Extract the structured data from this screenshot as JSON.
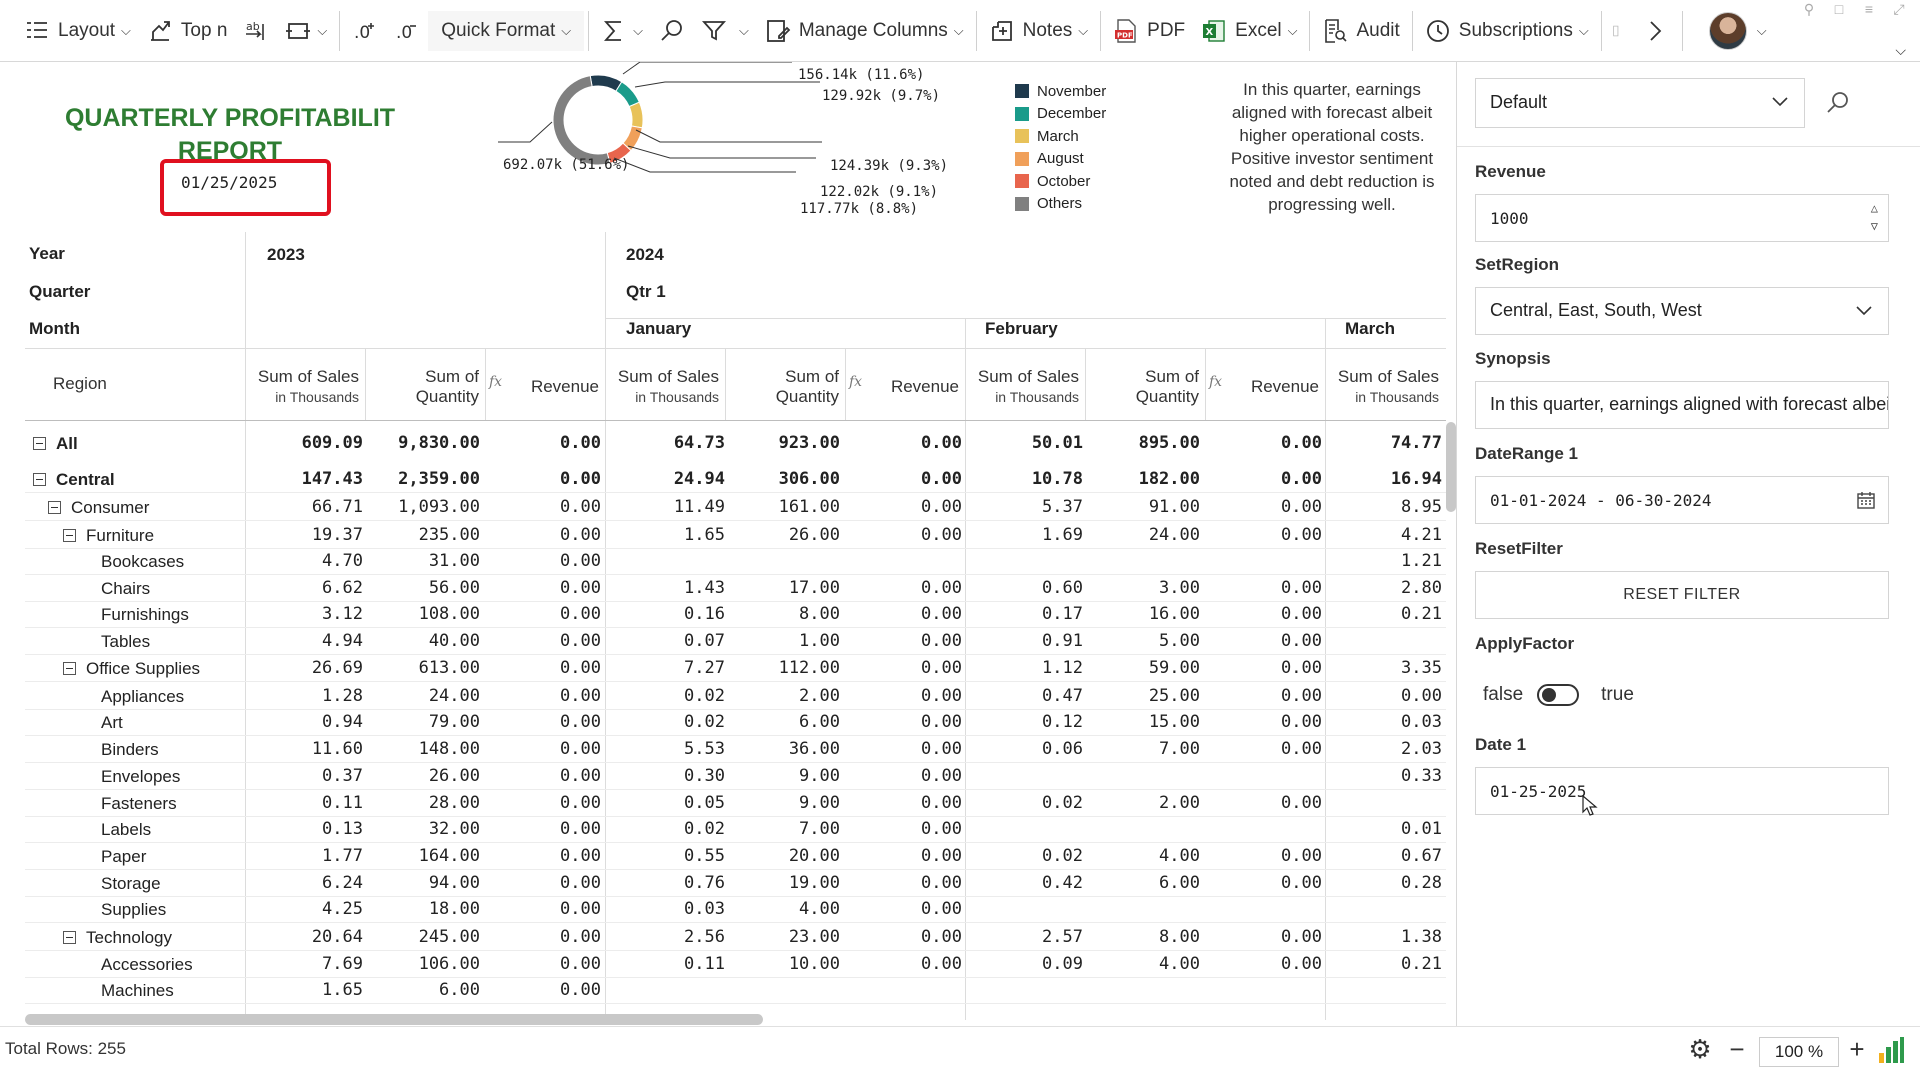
{
  "toolbar": {
    "layout": "Layout",
    "top_n": "Top n",
    "quick_format": "Quick Format",
    "manage_columns": "Manage Columns",
    "notes": "Notes",
    "pdf": "PDF",
    "excel": "Excel",
    "audit": "Audit",
    "subscriptions": "Subscriptions"
  },
  "report": {
    "title": "QUARTERLY PROFITABILIT REPORT",
    "date": "01/25/2025",
    "synopsis_text": "In this quarter, earnings aligned with forecast albeit higher operational costs. Positive investor sentiment noted and debt reduction is progressing well."
  },
  "donut": {
    "slices": [
      {
        "name": "November",
        "value": 156.14,
        "label": "156.14k (11.6%)",
        "color": "#1f3a4d"
      },
      {
        "name": "December",
        "value": 129.92,
        "label": "129.92k (9.7%)",
        "color": "#1a9b8a"
      },
      {
        "name": "March",
        "value": 124.39,
        "label": "124.39k (9.3%)",
        "color": "#e8c25a"
      },
      {
        "name": "August",
        "value": 122.02,
        "label": "122.02k (9.1%)",
        "color": "#f0a05a"
      },
      {
        "name": "October",
        "value": 117.77,
        "label": "117.77k (8.8%)",
        "color": "#e8654d"
      },
      {
        "name": "Others",
        "value": 692.07,
        "label": "692.07k (51.6%)",
        "color": "#808080"
      }
    ]
  },
  "grid": {
    "dims": {
      "year": "Year",
      "quarter": "Quarter",
      "month": "Month",
      "region": "Region"
    },
    "years": [
      "2023",
      "2024"
    ],
    "quarter": "Qtr 1",
    "months": [
      "January",
      "February",
      "March"
    ],
    "measures": {
      "sales": "Sum of Sales",
      "sales_sub": "in Thousands",
      "qty_a": "Sum of",
      "qty_b": "Quantity",
      "revenue": "Revenue",
      "fx": "fx"
    },
    "rows": [
      {
        "label": "All",
        "level": 0,
        "bold": true,
        "expander": true,
        "values": [
          "609.09",
          "9,830.00",
          "0.00",
          "64.73",
          "923.00",
          "0.00",
          "50.01",
          "895.00",
          "0.00",
          "74.77"
        ]
      },
      {
        "label": "Central",
        "level": 0,
        "bold": true,
        "expander": true,
        "values": [
          "147.43",
          "2,359.00",
          "0.00",
          "24.94",
          "306.00",
          "0.00",
          "10.78",
          "182.00",
          "0.00",
          "16.94"
        ]
      },
      {
        "label": "Consumer",
        "level": 1,
        "bold": false,
        "expander": true,
        "values": [
          "66.71",
          "1,093.00",
          "0.00",
          "11.49",
          "161.00",
          "0.00",
          "5.37",
          "91.00",
          "0.00",
          "8.95"
        ]
      },
      {
        "label": "Furniture",
        "level": 2,
        "bold": false,
        "expander": true,
        "values": [
          "19.37",
          "235.00",
          "0.00",
          "1.65",
          "26.00",
          "0.00",
          "1.69",
          "24.00",
          "0.00",
          "4.21"
        ]
      },
      {
        "label": "Bookcases",
        "level": 3,
        "bold": false,
        "expander": false,
        "values": [
          "4.70",
          "31.00",
          "0.00",
          "",
          "",
          "",
          "",
          "",
          "",
          "1.21"
        ]
      },
      {
        "label": "Chairs",
        "level": 3,
        "bold": false,
        "expander": false,
        "values": [
          "6.62",
          "56.00",
          "0.00",
          "1.43",
          "17.00",
          "0.00",
          "0.60",
          "3.00",
          "0.00",
          "2.80"
        ]
      },
      {
        "label": "Furnishings",
        "level": 3,
        "bold": false,
        "expander": false,
        "values": [
          "3.12",
          "108.00",
          "0.00",
          "0.16",
          "8.00",
          "0.00",
          "0.17",
          "16.00",
          "0.00",
          "0.21"
        ]
      },
      {
        "label": "Tables",
        "level": 3,
        "bold": false,
        "expander": false,
        "values": [
          "4.94",
          "40.00",
          "0.00",
          "0.07",
          "1.00",
          "0.00",
          "0.91",
          "5.00",
          "0.00",
          ""
        ]
      },
      {
        "label": "Office Supplies",
        "level": 2,
        "bold": false,
        "expander": true,
        "values": [
          "26.69",
          "613.00",
          "0.00",
          "7.27",
          "112.00",
          "0.00",
          "1.12",
          "59.00",
          "0.00",
          "3.35"
        ]
      },
      {
        "label": "Appliances",
        "level": 3,
        "bold": false,
        "expander": false,
        "values": [
          "1.28",
          "24.00",
          "0.00",
          "0.02",
          "2.00",
          "0.00",
          "0.47",
          "25.00",
          "0.00",
          "0.00"
        ]
      },
      {
        "label": "Art",
        "level": 3,
        "bold": false,
        "expander": false,
        "values": [
          "0.94",
          "79.00",
          "0.00",
          "0.02",
          "6.00",
          "0.00",
          "0.12",
          "15.00",
          "0.00",
          "0.03"
        ]
      },
      {
        "label": "Binders",
        "level": 3,
        "bold": false,
        "expander": false,
        "values": [
          "11.60",
          "148.00",
          "0.00",
          "5.53",
          "36.00",
          "0.00",
          "0.06",
          "7.00",
          "0.00",
          "2.03"
        ]
      },
      {
        "label": "Envelopes",
        "level": 3,
        "bold": false,
        "expander": false,
        "values": [
          "0.37",
          "26.00",
          "0.00",
          "0.30",
          "9.00",
          "0.00",
          "",
          "",
          "",
          "0.33"
        ]
      },
      {
        "label": "Fasteners",
        "level": 3,
        "bold": false,
        "expander": false,
        "values": [
          "0.11",
          "28.00",
          "0.00",
          "0.05",
          "9.00",
          "0.00",
          "0.02",
          "2.00",
          "0.00",
          ""
        ]
      },
      {
        "label": "Labels",
        "level": 3,
        "bold": false,
        "expander": false,
        "values": [
          "0.13",
          "32.00",
          "0.00",
          "0.02",
          "7.00",
          "0.00",
          "",
          "",
          "",
          "0.01"
        ]
      },
      {
        "label": "Paper",
        "level": 3,
        "bold": false,
        "expander": false,
        "values": [
          "1.77",
          "164.00",
          "0.00",
          "0.55",
          "20.00",
          "0.00",
          "0.02",
          "4.00",
          "0.00",
          "0.67"
        ]
      },
      {
        "label": "Storage",
        "level": 3,
        "bold": false,
        "expander": false,
        "values": [
          "6.24",
          "94.00",
          "0.00",
          "0.76",
          "19.00",
          "0.00",
          "0.42",
          "6.00",
          "0.00",
          "0.28"
        ]
      },
      {
        "label": "Supplies",
        "level": 3,
        "bold": false,
        "expander": false,
        "values": [
          "4.25",
          "18.00",
          "0.00",
          "0.03",
          "4.00",
          "0.00",
          "",
          "",
          "",
          ""
        ]
      },
      {
        "label": "Technology",
        "level": 2,
        "bold": false,
        "expander": true,
        "values": [
          "20.64",
          "245.00",
          "0.00",
          "2.56",
          "23.00",
          "0.00",
          "2.57",
          "8.00",
          "0.00",
          "1.38"
        ]
      },
      {
        "label": "Accessories",
        "level": 3,
        "bold": false,
        "expander": false,
        "values": [
          "7.69",
          "106.00",
          "0.00",
          "0.11",
          "10.00",
          "0.00",
          "0.09",
          "4.00",
          "0.00",
          "0.21"
        ]
      },
      {
        "label": "Machines",
        "level": 3,
        "bold": false,
        "expander": false,
        "values": [
          "1.65",
          "6.00",
          "0.00",
          "",
          "",
          "",
          "",
          "",
          "",
          ""
        ]
      }
    ]
  },
  "panel": {
    "layout_value": "Default",
    "revenue_label": "Revenue",
    "revenue_value": "1000",
    "setregion_label": "SetRegion",
    "setregion_value": "Central, East, South, West",
    "synopsis_label": "Synopsis",
    "synopsis_value": "In this quarter, earnings aligned with forecast albeit higher operational costs.",
    "daterange_label": "DateRange 1",
    "daterange_value": "01-01-2024 - 06-30-2024",
    "resetfilter_label": "ResetFilter",
    "reset_button": "RESET FILTER",
    "applyfactor_label": "ApplyFactor",
    "toggle_false": "false",
    "toggle_true": "true",
    "date1_label": "Date 1",
    "date1_value": "01-25-2025"
  },
  "status": {
    "total_rows": "Total Rows: 255",
    "zoom": "100 %"
  }
}
